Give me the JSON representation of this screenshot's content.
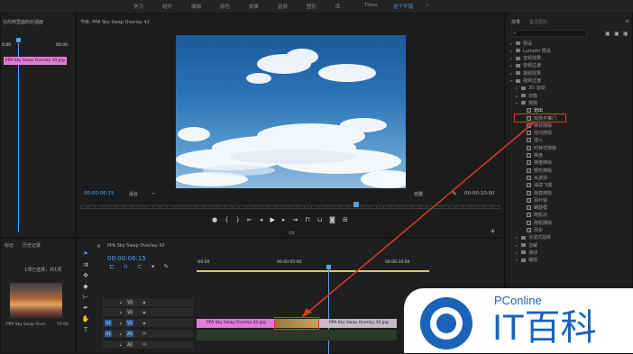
{
  "menu": [
    "学习",
    "组件",
    "编辑",
    "颜色",
    "效果",
    "音频",
    "图形",
    "库",
    "Titles",
    "这个不错"
  ],
  "active_menu_index": 9,
  "source": {
    "title": "在的用里面的对话面",
    "clip_label": "PPA Sky Swap Overlay 30.jpg",
    "timecode_right": "00:00"
  },
  "program": {
    "title": "节目: PPA Sky Swap Overlay 42",
    "tc_left": "00:00:06:15",
    "fit": "适合",
    "quality": "完整",
    "tc_right": "00:00:10:00"
  },
  "effects": {
    "tabs": [
      "效果",
      "基本图形"
    ],
    "search_placeholder": "",
    "items": [
      {
        "label": "预设",
        "depth": 0,
        "type": "folder",
        "open": false
      },
      {
        "label": "Lumetri 预设",
        "depth": 0,
        "type": "folder",
        "open": false
      },
      {
        "label": "音频效果",
        "depth": 0,
        "type": "folder",
        "open": false
      },
      {
        "label": "音频过渡",
        "depth": 0,
        "type": "folder",
        "open": false
      },
      {
        "label": "视频效果",
        "depth": 0,
        "type": "folder",
        "open": false
      },
      {
        "label": "视频过渡",
        "depth": 0,
        "type": "folder",
        "open": true
      },
      {
        "label": "3D 运动",
        "depth": 1,
        "type": "folder",
        "open": false
      },
      {
        "label": "划像",
        "depth": 1,
        "type": "folder",
        "open": false
      },
      {
        "label": "擦除",
        "depth": 1,
        "type": "folder",
        "open": true
      },
      {
        "label": "划出",
        "depth": 2,
        "type": "effect",
        "selected": true
      },
      {
        "label": "双侧平推门",
        "depth": 2,
        "type": "effect"
      },
      {
        "label": "带状擦除",
        "depth": 2,
        "type": "effect"
      },
      {
        "label": "径向擦除",
        "depth": 2,
        "type": "effect"
      },
      {
        "label": "插入",
        "depth": 2,
        "type": "effect"
      },
      {
        "label": "时钟式擦除",
        "depth": 2,
        "type": "effect"
      },
      {
        "label": "棋盘",
        "depth": 2,
        "type": "effect"
      },
      {
        "label": "棋盘擦除",
        "depth": 2,
        "type": "effect"
      },
      {
        "label": "楔形擦除",
        "depth": 2,
        "type": "effect"
      },
      {
        "label": "水波块",
        "depth": 2,
        "type": "effect"
      },
      {
        "label": "油漆飞溅",
        "depth": 2,
        "type": "effect"
      },
      {
        "label": "渐变擦除",
        "depth": 2,
        "type": "effect"
      },
      {
        "label": "百叶窗",
        "depth": 2,
        "type": "effect"
      },
      {
        "label": "螺旋框",
        "depth": 2,
        "type": "effect"
      },
      {
        "label": "随机块",
        "depth": 2,
        "type": "effect"
      },
      {
        "label": "随机擦除",
        "depth": 2,
        "type": "effect"
      },
      {
        "label": "风车",
        "depth": 2,
        "type": "effect"
      },
      {
        "label": "沉浸式视频",
        "depth": 1,
        "type": "folder",
        "open": false
      },
      {
        "label": "溶解",
        "depth": 1,
        "type": "folder",
        "open": false
      },
      {
        "label": "滑动",
        "depth": 1,
        "type": "folder",
        "open": false
      },
      {
        "label": "缩放",
        "depth": 1,
        "type": "folder",
        "open": false
      }
    ]
  },
  "project": {
    "tabs": [
      "标记",
      "历史记录"
    ],
    "selection": "1项已选择，共1项",
    "thumb_name": "PPA Sky Swap Over...",
    "thumb_duration": "10:00"
  },
  "timeline": {
    "title": "PPA Sky Swap Overlay 42",
    "tc": "00:00:06:15",
    "ruler": [
      ":00:00",
      "00:00:05:00",
      "00:00:10:00"
    ],
    "tracks": [
      {
        "name": "V3"
      },
      {
        "name": "V2"
      },
      {
        "name": "V1",
        "src": "V1"
      },
      {
        "name": "A1",
        "src": "A1"
      },
      {
        "name": "A2"
      }
    ],
    "clips": {
      "left": "PPA Sky Swap Overlay 42.jpg",
      "right": "PPA Sky Swap Overlay 30.jpg"
    }
  },
  "watermark": {
    "brand": "PConline",
    "cn": "IT百科"
  },
  "colors": {
    "accent": "#4da0e8",
    "clip_pink": "#e27ad9",
    "highlight": "#e03a2a",
    "blue_tc": "#4ea3ff"
  }
}
